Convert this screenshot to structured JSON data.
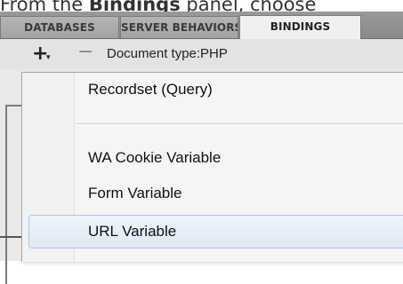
{
  "caption": {
    "prefix": "From the ",
    "bold": "Bindings",
    "suffix": " panel, choose"
  },
  "tabs": [
    {
      "label": "DATABASES",
      "active": false
    },
    {
      "label": "SERVER BEHAVIORS",
      "active": false
    },
    {
      "label": "BINDINGS",
      "active": true
    }
  ],
  "toolbar": {
    "add_symbol": "+",
    "add_arrow": "▾",
    "remove_symbol": "−",
    "document_type": "Document type:PHP"
  },
  "menu": {
    "items": [
      {
        "label": "Recordset (Query)",
        "highlighted": false
      },
      {
        "label": "WA Cookie Variable",
        "highlighted": false
      },
      {
        "label": "Form Variable",
        "highlighted": false
      },
      {
        "label": "URL Variable",
        "highlighted": true
      }
    ]
  },
  "colors": {
    "highlight_border": "#a9c6e3",
    "highlight_fill": "#dde9f5",
    "tabbar": "#8a8a8a"
  }
}
